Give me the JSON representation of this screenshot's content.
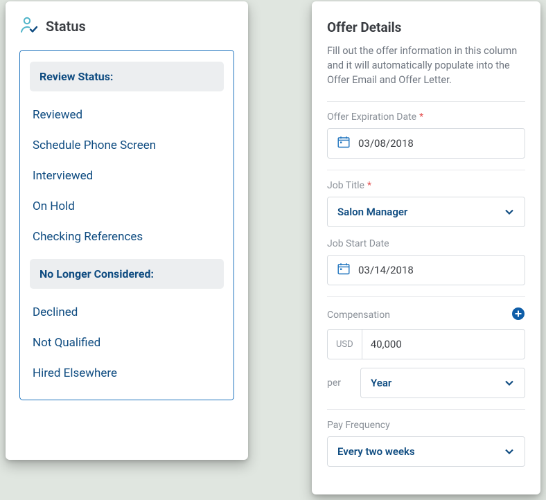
{
  "status": {
    "title": "Status",
    "review_header": "Review Status:",
    "review_items": [
      "Reviewed",
      "Schedule Phone Screen",
      "Interviewed",
      "On Hold",
      "Checking References"
    ],
    "nlc_header": "No Longer Considered:",
    "nlc_items": [
      "Declined",
      "Not Qualified",
      "Hired Elsewhere"
    ]
  },
  "offer": {
    "title": "Offer Details",
    "description": "Fill out the offer information in this column and it will automatically populate into the Offer Email and Offer Letter.",
    "expiration_label": "Offer Expiration Date",
    "expiration_value": "03/08/2018",
    "job_title_label": "Job Title",
    "job_title_value": "Salon Manager",
    "start_label": "Job Start Date",
    "start_value": "03/14/2018",
    "compensation_label": "Compensation",
    "currency": "USD",
    "amount": "40,000",
    "per_label": "per",
    "per_value": "Year",
    "pay_freq_label": "Pay Frequency",
    "pay_freq_value": "Every two weeks",
    "required_mark": "*"
  }
}
